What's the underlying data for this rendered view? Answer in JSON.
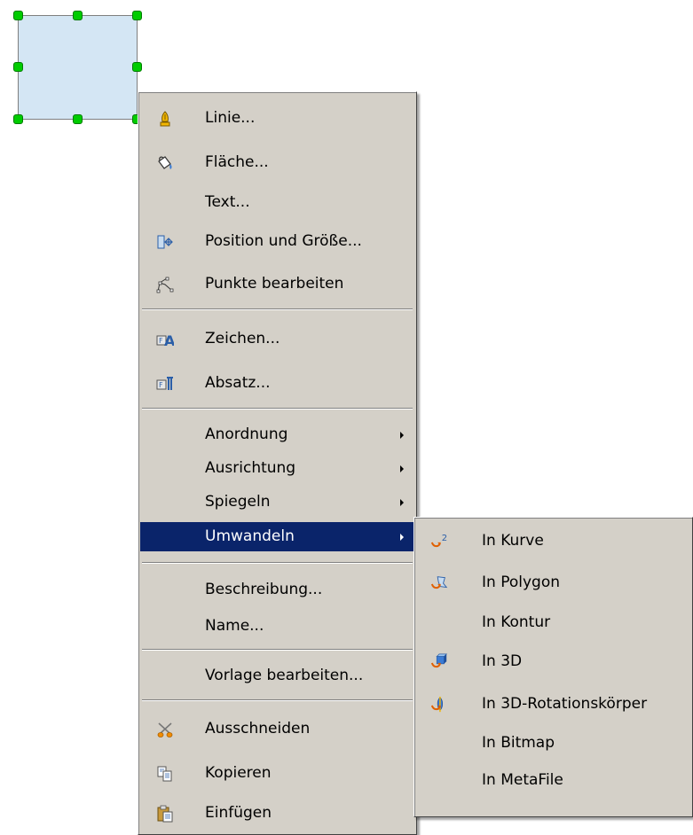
{
  "context_menu": {
    "items": [
      {
        "label": "Linie...",
        "icon": "line-pen-icon"
      },
      {
        "label": "Fläche...",
        "icon": "paint-bucket-icon"
      },
      {
        "label": "Text...",
        "icon": ""
      },
      {
        "label": "Position und Größe...",
        "icon": "position-size-icon"
      },
      {
        "label": "Punkte bearbeiten",
        "icon": "edit-points-icon"
      },
      {
        "label": "Zeichen...",
        "icon": "character-icon"
      },
      {
        "label": "Absatz...",
        "icon": "paragraph-icon"
      },
      {
        "label": "Anordnung",
        "submenu": true
      },
      {
        "label": "Ausrichtung",
        "submenu": true
      },
      {
        "label": "Spiegeln",
        "submenu": true
      },
      {
        "label": "Umwandeln",
        "submenu": true,
        "highlighted": true
      },
      {
        "label": "Beschreibung..."
      },
      {
        "label": "Name..."
      },
      {
        "label": "Vorlage bearbeiten..."
      },
      {
        "label": "Ausschneiden",
        "icon": "scissors-icon"
      },
      {
        "label": "Kopieren",
        "icon": "copy-icon"
      },
      {
        "label": "Einfügen",
        "icon": "paste-icon"
      }
    ]
  },
  "convert_submenu": {
    "items": [
      {
        "label": "In Kurve",
        "icon": "to-curve-icon"
      },
      {
        "label": "In Polygon",
        "icon": "to-polygon-icon"
      },
      {
        "label": "In Kontur"
      },
      {
        "label": "In 3D",
        "icon": "to-3d-icon"
      },
      {
        "label": "In 3D-Rotationskörper",
        "icon": "to-3d-rotation-icon"
      },
      {
        "label": "In Bitmap"
      },
      {
        "label": "In MetaFile"
      }
    ]
  },
  "colors": {
    "menu_bg": "#d4d0c8",
    "highlight_bg": "#0a246a",
    "shape_fill": "#d4e6f4",
    "handle": "#00cc00"
  }
}
